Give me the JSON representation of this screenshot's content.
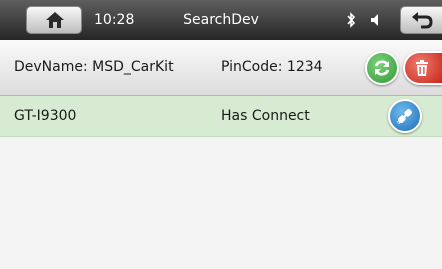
{
  "statusbar": {
    "time": "10:28",
    "title": "SearchDev",
    "home_icon": "home-icon",
    "bluetooth_icon": "bluetooth-icon",
    "volume_icon": "volume-icon",
    "back_icon": "back-icon"
  },
  "paired_device": {
    "name": "DevName: MSD_CarKit",
    "pincode": "PinCode: 1234",
    "refresh_icon": "refresh-icon",
    "delete_icon": "trash-icon"
  },
  "devices": [
    {
      "name": "GT-I9300",
      "status": "Has Connect",
      "action_icon": "link-icon"
    }
  ],
  "colors": {
    "statusbar": "#3a3a3a",
    "connected_row": "#d6ebd2",
    "refresh": "#3aa63c",
    "delete": "#d8362a",
    "connect": "#2a7fcc"
  }
}
